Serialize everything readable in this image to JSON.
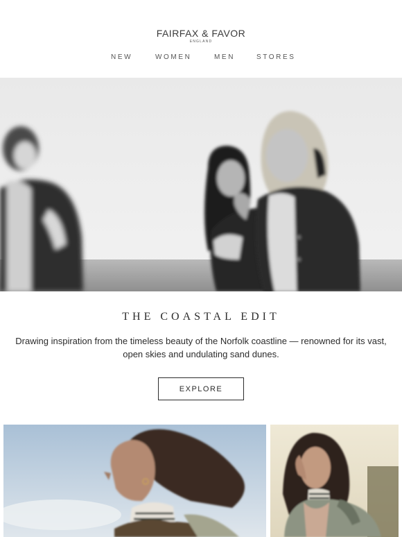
{
  "brand": {
    "name": "FAIRFAX & FAVOR",
    "location": "ENGLAND"
  },
  "nav": {
    "items": [
      {
        "label": "NEW"
      },
      {
        "label": "WOMEN"
      },
      {
        "label": "MEN"
      },
      {
        "label": "STORES"
      }
    ]
  },
  "hero": {
    "image_desc": "hero-photo",
    "tone": "black-and-white"
  },
  "edit": {
    "title": "THE COASTAL EDIT",
    "description": "Drawing inspiration from the timeless beauty of the Norfolk coastline — renowned for its vast, open skies and undulating sand dunes.",
    "cta_label": "EXPLORE"
  },
  "colors": {
    "text": "#2b2b2b",
    "nav_text": "#555555",
    "sky_left": "#c7d6e3",
    "sky_right": "#e6e2d2"
  }
}
